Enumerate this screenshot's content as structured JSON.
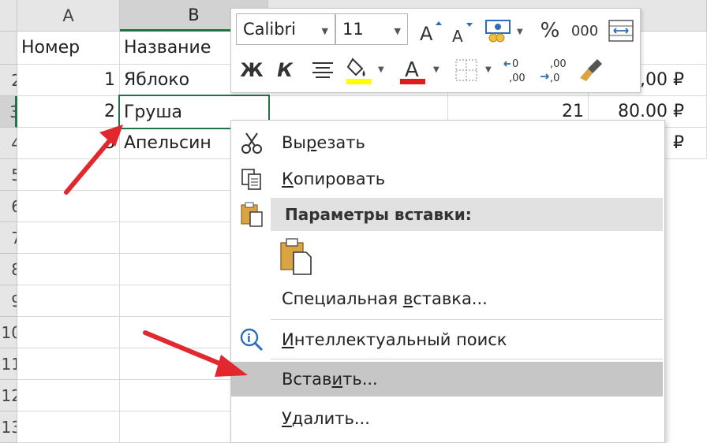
{
  "sheet": {
    "columns": [
      "A",
      "B"
    ],
    "rows": [
      "",
      "2",
      "3",
      "4",
      "5",
      "6",
      "7",
      "8",
      "9",
      "10",
      "11",
      "12",
      "13"
    ],
    "header_row": [
      "Номер",
      "Название"
    ],
    "data": [
      {
        "num": "1",
        "name": "Яблоко"
      },
      {
        "num": "2",
        "name": "Груша"
      },
      {
        "num": "3",
        "name": "Апельсин"
      }
    ],
    "extra": {
      "qty": "21",
      "price_row2": "80.00 ₽",
      "price_row1_partial": ",00 ₽",
      "price_row3_partial": "₽"
    }
  },
  "mini_toolbar": {
    "font_name": "Calibri",
    "font_size": "11",
    "bold": "Ж",
    "italic": "К",
    "percent": "%",
    "thousands": "000",
    "font_color": "#e01b1b",
    "fill_color": "#ffff00",
    "icons": [
      "increase-font-icon",
      "decrease-font-icon",
      "accounting-format-icon",
      "merge-center-icon",
      "align-icon",
      "fill-color-icon",
      "font-color-icon",
      "borders-icon",
      "decrease-decimal-icon",
      "increase-decimal-icon",
      "format-painter-icon"
    ]
  },
  "context_menu": {
    "cut": {
      "pre": "Вы",
      "u": "р",
      "post": "езать"
    },
    "copy": {
      "pre": "",
      "u": "К",
      "post": "опировать"
    },
    "paste_options": "Параметры вставки:",
    "paste_special": {
      "pre": "Специальная ",
      "u": "в",
      "post": "ставка..."
    },
    "smart_lookup": {
      "pre": "",
      "u": "И",
      "post": "нтеллектуальный поиск"
    },
    "insert": {
      "pre": "Встав",
      "u": "и",
      "post": "ть..."
    },
    "delete": {
      "pre": "",
      "u": "У",
      "post": "далить..."
    }
  },
  "colors": {
    "accent": "#217346",
    "arrow": "#e0282e",
    "highlight": "#c6c6c6"
  }
}
